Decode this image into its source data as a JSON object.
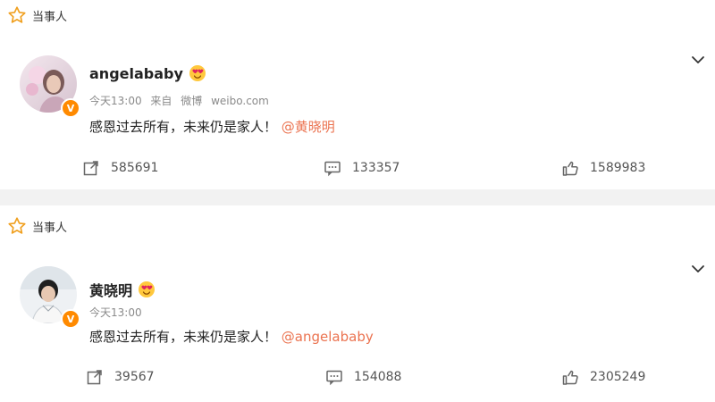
{
  "posts": [
    {
      "tag": "当事人",
      "user": "angelababy",
      "time": "今天13:00",
      "source_prefix": "来自",
      "source_apps": [
        "微博",
        "weibo.com"
      ],
      "text": "感恩过去所有，未来仍是家人！",
      "mention": "@黄晓明",
      "repost_count": "585691",
      "comment_count": "133357",
      "like_count": "1589983"
    },
    {
      "tag": "当事人",
      "user": "黄晓明",
      "time": "今天13:00",
      "text": "感恩过去所有，未来仍是家人！",
      "mention": "@angelababy",
      "repost_count": "39567",
      "comment_count": "154088",
      "like_count": "2305249"
    }
  ],
  "colors": {
    "accent": "#eb7350",
    "verified": "#ff8a00",
    "separator": "#f2f2f2"
  },
  "icons": [
    "star-outline-icon",
    "chevron-down-icon",
    "repost-icon",
    "comment-icon",
    "like-icon",
    "verified-badge",
    "love-eyes-emoji"
  ]
}
